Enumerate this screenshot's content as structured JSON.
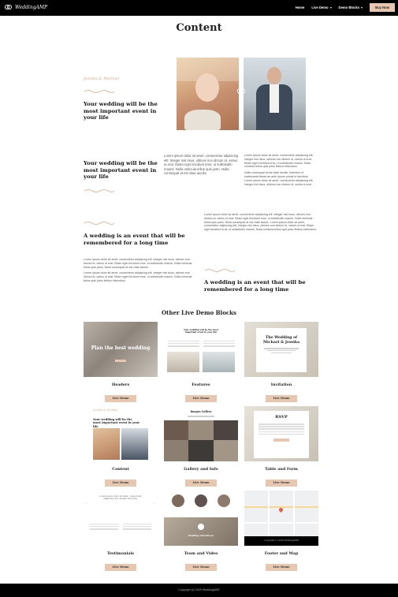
{
  "nav": {
    "logo": "WeddingAMP",
    "links": [
      "Home",
      "Live Demo",
      "Demo Blocks"
    ],
    "buy": "Buy Now"
  },
  "page_title": "Content",
  "section1": {
    "names": "Jessika & Michael",
    "heading": "Your wedding will be the most important event in your life"
  },
  "section2": {
    "heading": "Your wedding will be the most important event in your life",
    "para_large": "Lorem ipsum dolor sit amet, consectetur adipiscing elit. Integer nisl risus, ultrices non dictum id, varius ut erat. Etiam eget tincidunt eros, ut sollicitudin mauris. Nulla vehicula tellus quis justo, Nulla consequat at est vitae iaculis.",
    "para_small_1": "Lorem ipsum dolor sit amet, consectetur adipiscing elit. Integer nisl risus, ultrices non dictum id, varius ut erat. Etiam eget tincidunt eros, ut sollicitudin mauris. Nulla vehicula tellus quis justo finibus bibendum.",
    "para_small_2": "Nulla consequat at est vitae iaculis. Interdum et malesuada fames ac ante ipsum primis in faucibus. Lorem ipsum dolor sit amet, consectetur adipiscing elit. Integer nisl risus, ultrices non dictum id, varius ut erat."
  },
  "section3": {
    "heading": "A wedding is an event that will be remembered for a long time",
    "para": "Lorem ipsum dolor sit amet, consectetur adipiscing elit. Integer nisl risus, ultrices non dictum id, varius ut erat. Etiam eget tincidunt eros, ut sollicitudin mauris. Nulla vehicula tellus quis justo, Nulla consequat at est vitae iaculis. Lorem ipsum dolor sit amet, consectetur adipiscing elit. Integer nisl risus, ultrices non dictum id, varius ut erat. Etiam eget tincidunt eros, ut sollicitudin mauris. Nulla vehicula tellus quis justo finibus bibendum."
  },
  "section4": {
    "heading": "A wedding is an event that will be remembered for a long time",
    "para_1": "Lorem ipsum dolor sit amet, consectetur adipiscing elit. Integer nisl risus, ultrices non dictum id, varius ut erat. Etiam eget tincidunt eros, ut sollicitudin mauris. Nulla vehicula tellus quis justo. Nulla consequat at est vitae iaculis.",
    "para_2": "Lorem ipsum dolor sit amet, consectetur adipiscing elit. Integer nisl risus, ultrices non dictum id, varius ut erat. Etiam eget tincidunt eros, ut sollicitudin mauris. Nulla vehicula tellus quis justo finibus bibendum."
  },
  "other_title": "Other Live Demo Blocks",
  "demo_button": "Live Demo",
  "cards": [
    {
      "title": "Headers",
      "thumb_text": "Plan the best wedding"
    },
    {
      "title": "Features",
      "thumb_text": "Your wedding will be the most important event in your life"
    },
    {
      "title": "Invitation",
      "thumb_text": "The Wedding of Michael & Jessika"
    },
    {
      "title": "Content",
      "thumb_text": "Your wedding will be the most important event in your life",
      "thumb_names": "Jessika & Michael"
    },
    {
      "title": "Gallery and Info",
      "thumb_text": "Images Gallery"
    },
    {
      "title": "Table and Form",
      "thumb_text": "RSVP"
    },
    {
      "title": "Testimonials",
      "thumb_text": "Lorem ipsum dolor sit amet, consectetur adipiscing elit. Integer nisl risus."
    },
    {
      "title": "Team and Video",
      "thumb_text": "Wedding Adventures"
    },
    {
      "title": "Footer and Map",
      "thumb_text": "Copyright (c) 2020 WeddingAMP"
    }
  ],
  "footer": "Copyright (c) 2020 WeddingAMP",
  "colors": {
    "accent": "#e8c7b0",
    "cursive": "#d9a989",
    "dark": "#000000"
  }
}
